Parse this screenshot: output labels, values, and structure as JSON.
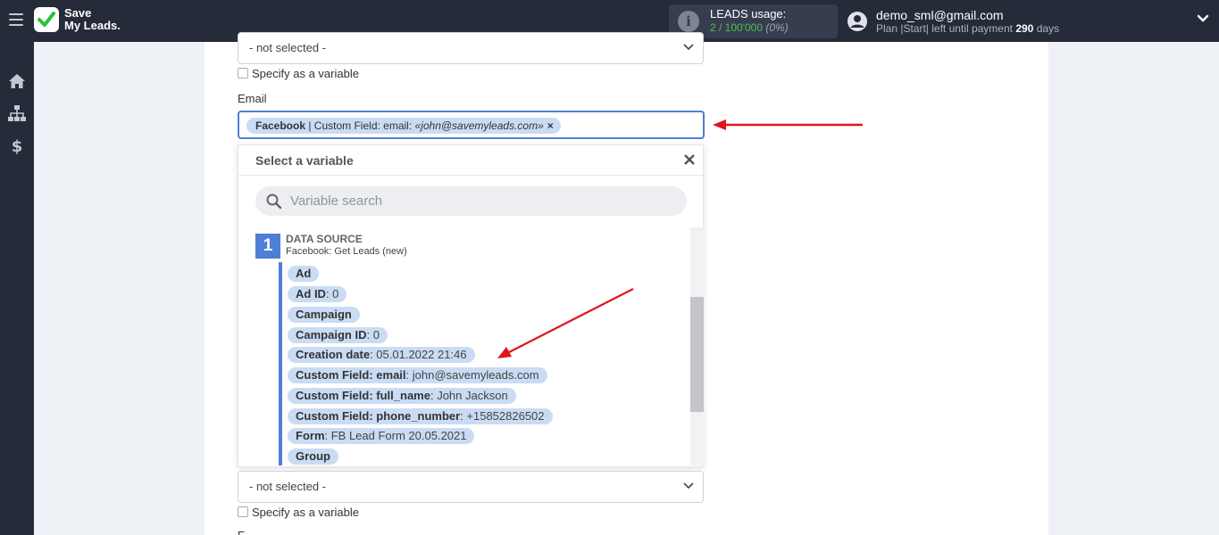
{
  "app": {
    "logo_text_line1": "Save",
    "logo_text_line2": "My Leads."
  },
  "usage": {
    "label": "LEADS usage:",
    "value": "2 / 100'000",
    "percent": "(0%)"
  },
  "user": {
    "email": "demo_sml@gmail.com",
    "plan_prefix": "Plan |Start| left until payment",
    "days_left": "290",
    "days_suffix": "days"
  },
  "sidebar": {
    "items": [
      {
        "icon": "home-icon"
      },
      {
        "icon": "sitemap-icon"
      },
      {
        "icon": "dollar-icon"
      }
    ]
  },
  "form": {
    "top_select_value": "- not selected -",
    "specify_variable_label": "Specify as a variable",
    "email_label": "Email",
    "email_tag": {
      "source": "Facebook",
      "field": " | Custom Field: email: ",
      "value": "«john@savemyleads.com»",
      "remove": "×"
    },
    "bottom_select_value": "- not selected -",
    "bottom_specify_label": "Specify as a variable",
    "next_label_partial": "F"
  },
  "dropdown": {
    "title": "Select a variable",
    "search_placeholder": "Variable search",
    "source": {
      "number": "1",
      "title": "DATA SOURCE",
      "subtitle": "Facebook: Get Leads (new)"
    },
    "variables": [
      {
        "name": "Ad",
        "value": ""
      },
      {
        "name": "Ad ID",
        "value": ": 0"
      },
      {
        "name": "Campaign",
        "value": ""
      },
      {
        "name": "Campaign ID",
        "value": ": 0"
      },
      {
        "name": "Creation date",
        "value": ": 05.01.2022 21:46"
      },
      {
        "name": "Custom Field: email",
        "value": ": john@savemyleads.com"
      },
      {
        "name": "Custom Field: full_name",
        "value": ": John Jackson"
      },
      {
        "name": "Custom Field: phone_number",
        "value": ": +15852826502"
      },
      {
        "name": "Form",
        "value": ": FB Lead Form 20.05.2021"
      },
      {
        "name": "Group",
        "value": ""
      }
    ]
  },
  "colors": {
    "topbar": "#262b3a",
    "accent": "#4d7fd6",
    "chip": "#c9dcf4",
    "annotation_arrow": "#e0141b",
    "usage_green": "#4fbf53"
  }
}
